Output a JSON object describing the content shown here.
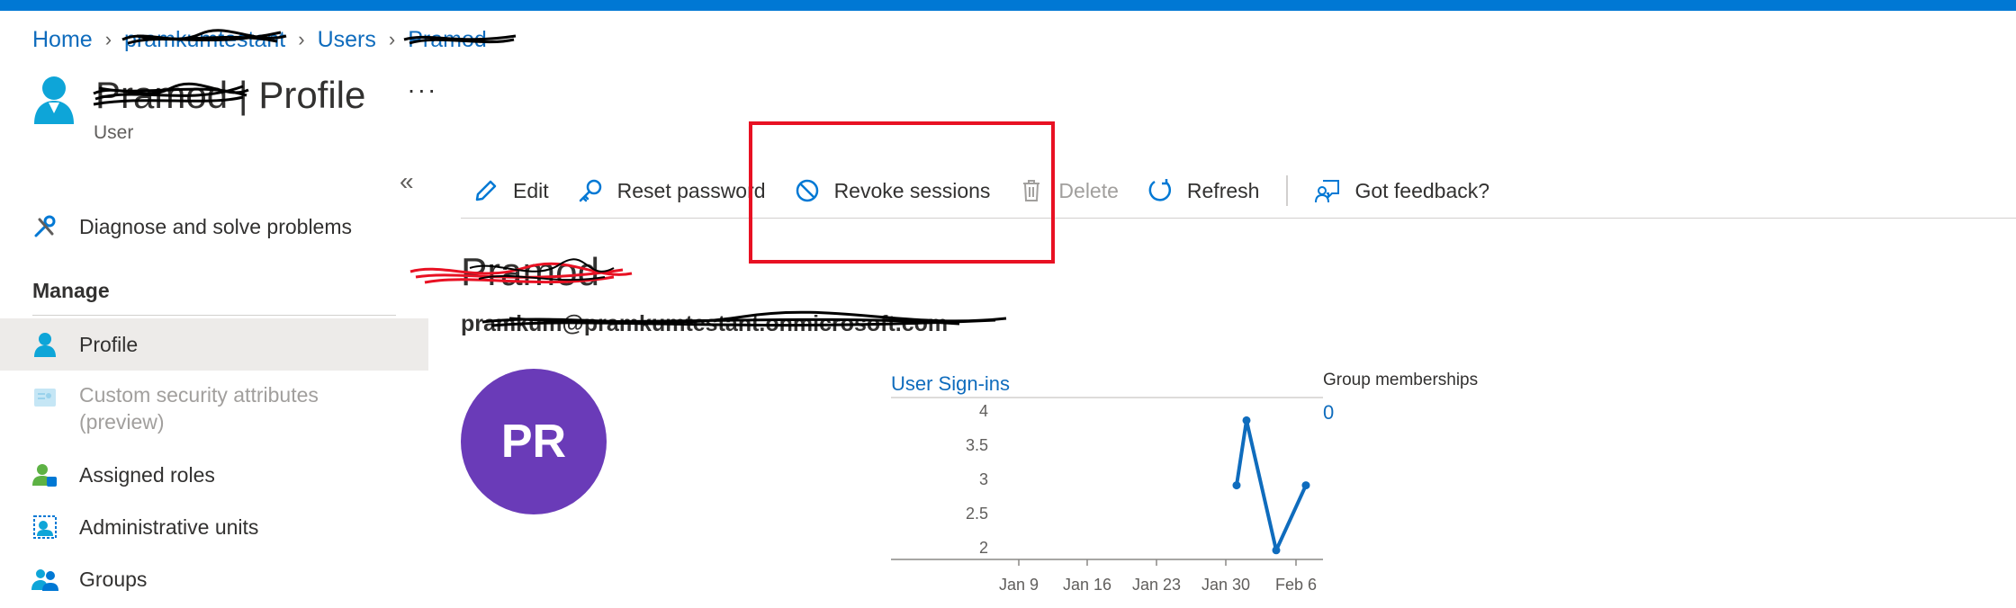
{
  "breadcrumb": {
    "home": "Home",
    "tenant": "pramkumtestant",
    "users": "Users",
    "current": "Pramod"
  },
  "header": {
    "user_name": "Pramod",
    "page_suffix": "| Profile",
    "subtitle": "User",
    "more": "···",
    "collapse": "«"
  },
  "sidebar": {
    "diagnose": "Diagnose and solve problems",
    "section_manage": "Manage",
    "items": [
      {
        "label": "Profile",
        "selected": true
      },
      {
        "label": "Custom security attributes (preview)",
        "disabled": true
      },
      {
        "label": "Assigned roles"
      },
      {
        "label": "Administrative units"
      },
      {
        "label": "Groups"
      }
    ]
  },
  "toolbar": {
    "edit": "Edit",
    "reset_password": "Reset password",
    "revoke_sessions": "Revoke sessions",
    "delete": "Delete",
    "refresh": "Refresh",
    "feedback": "Got feedback?"
  },
  "profile": {
    "display_name": "Pramod",
    "email": "pramkum@pramkumtestant.onmicrosoft.com",
    "initials": "PR"
  },
  "signins": {
    "title": "User Sign-ins"
  },
  "group_memberships": {
    "label": "Group memberships",
    "value": "0"
  },
  "colors": {
    "accent": "#0078d4",
    "avatar": "#6a3bb8",
    "highlight_box": "#e81123",
    "line": "#0f6cbd"
  },
  "chart_data": {
    "type": "line",
    "title": "User Sign-ins",
    "y_ticks": [
      "4",
      "3.5",
      "3",
      "2.5",
      "2"
    ],
    "x_ticks": [
      "Jan 9",
      "Jan 16",
      "Jan 23",
      "Jan 30",
      "Feb 6"
    ],
    "ylim": [
      2,
      4
    ],
    "xlim_days": [
      0,
      35
    ],
    "series": [
      {
        "points": [
          {
            "x": "Jan 31",
            "y": 2.9
          },
          {
            "x": "Feb 1",
            "y": 3.85
          },
          {
            "x": "Feb 4",
            "y": 1.95
          },
          {
            "x": "Feb 7",
            "y": 2.9
          }
        ]
      }
    ]
  }
}
